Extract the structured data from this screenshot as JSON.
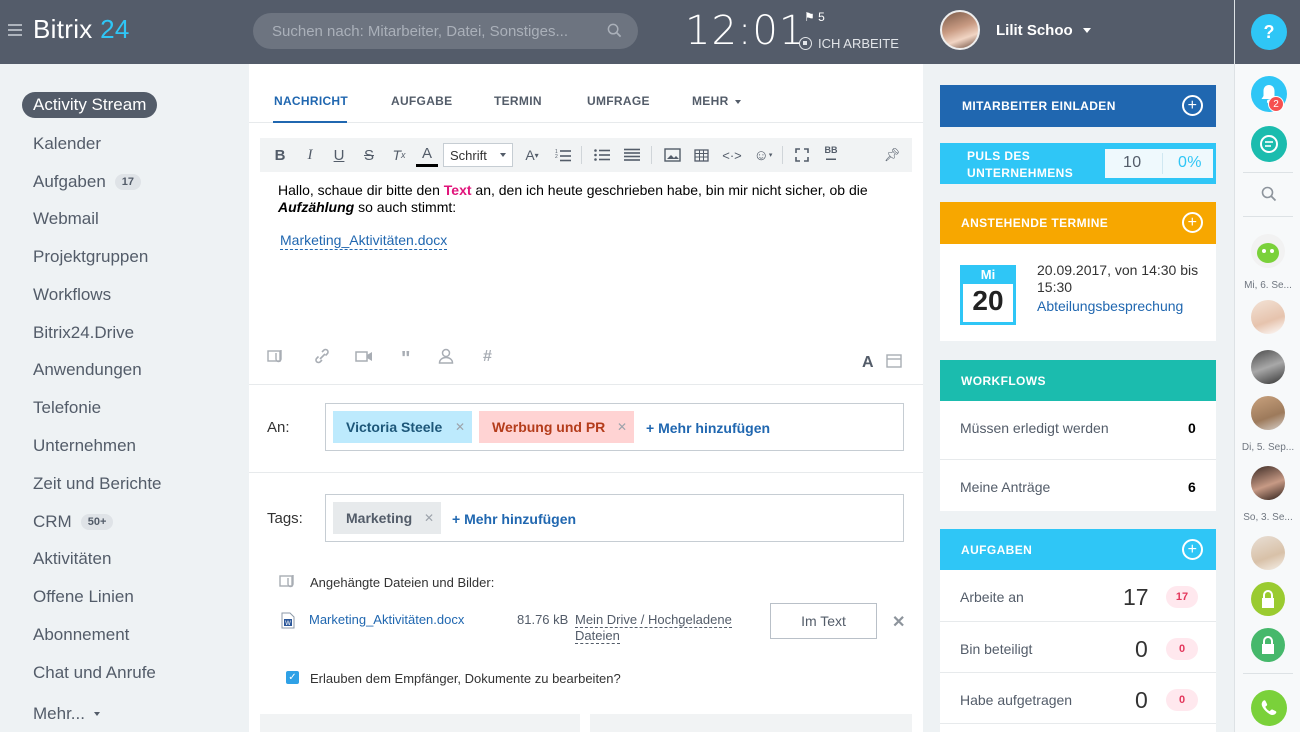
{
  "header": {
    "logo_text": "Bitrix",
    "logo_num": "24",
    "search_placeholder": "Suchen nach: Mitarbeiter, Datei, Sonstiges...",
    "clock": "12:01",
    "flag_count": "5",
    "work_status": "ICH ARBEITE",
    "user_name": "Lilit Schoo"
  },
  "sidebar": {
    "items": [
      {
        "label": "Activity Stream",
        "badge": ""
      },
      {
        "label": "Kalender",
        "badge": ""
      },
      {
        "label": "Aufgaben",
        "badge": "17"
      },
      {
        "label": "Webmail",
        "badge": ""
      },
      {
        "label": "Projektgruppen",
        "badge": ""
      },
      {
        "label": "Workflows",
        "badge": ""
      },
      {
        "label": "Bitrix24.Drive",
        "badge": ""
      },
      {
        "label": "Anwendungen",
        "badge": ""
      },
      {
        "label": "Telefonie",
        "badge": ""
      },
      {
        "label": "Unternehmen",
        "badge": ""
      },
      {
        "label": "Zeit und Berichte",
        "badge": ""
      },
      {
        "label": "CRM",
        "badge": "50+"
      },
      {
        "label": "Aktivitäten",
        "badge": ""
      },
      {
        "label": "Offene Linien",
        "badge": ""
      },
      {
        "label": "Abonnement",
        "badge": ""
      },
      {
        "label": "Chat und Anrufe",
        "badge": ""
      },
      {
        "label": "Mehr...",
        "badge": ""
      }
    ]
  },
  "composer": {
    "tabs": [
      "NACHRICHT",
      "AUFGABE",
      "TERMIN",
      "UMFRAGE",
      "MEHR"
    ],
    "font_select": "Schrift",
    "bbcode": "BB",
    "message_part1": "Hallo, schaue dir bitte den ",
    "message_highlight": "Text",
    "message_part2": " an, den ich heute geschrieben habe, bin mir nicht sicher, ob die",
    "message_italic": "Aufzählung",
    "message_part3": " so auch stimmt:",
    "inline_file": "Marketing_Aktivitäten.docx",
    "text_format_icon": "A",
    "to_label": "An:",
    "recipients": [
      "Victoria Steele",
      "Werbung und PR"
    ],
    "add_more": "+ Mehr hinzufügen",
    "tags_label": "Tags:",
    "tags": [
      "Marketing"
    ],
    "attachments_title": "Angehängte Dateien und Bilder:",
    "file": {
      "name": "Marketing_Aktivitäten.docx",
      "size": "81.76 kB",
      "path": "Mein Drive / Hochgeladene Dateien",
      "insert_label": "Im Text"
    },
    "allow_edit_label": "Erlauben dem Empfänger, Dokumente zu bearbeiten?",
    "allow_edit_checked": true
  },
  "right_panel": {
    "invite": "MITARBEITER EINLADEN",
    "pulse_title": "PULS DES UNTERNEHMENS",
    "pulse_value": "10",
    "pulse_percent": "0%",
    "events_title": "ANSTEHENDE TERMINE",
    "event": {
      "weekday": "Mi",
      "day": "20",
      "time": "20.09.2017, von 14:30 bis 15:30",
      "title": "Abteilungsbesprechung"
    },
    "workflows_title": "WORKFLOWS",
    "workflows": [
      {
        "label": "Müssen erledigt werden",
        "value": "0"
      },
      {
        "label": "Meine Anträge",
        "value": "6"
      }
    ],
    "tasks_title": "AUFGABEN",
    "tasks": [
      {
        "label": "Arbeite an",
        "value": "17",
        "badge": "17"
      },
      {
        "label": "Bin beteiligt",
        "value": "0",
        "badge": "0"
      },
      {
        "label": "Habe aufgetragen",
        "value": "0",
        "badge": "0"
      }
    ]
  },
  "rail": {
    "help": "?",
    "notif_count": "2",
    "dates": [
      "Mi, 6. Se...",
      "Di, 5. Sep...",
      "So, 3. Se..."
    ]
  },
  "colors": {
    "topbar": "#545c6a",
    "accent_blue": "#2fc6f6",
    "invite_blue": "#2067b0",
    "events_orange": "#f7a700",
    "workflows_teal": "#1bbcae",
    "tasks_cyan": "#2fc6f6",
    "highlight_pink": "#e0157b"
  }
}
